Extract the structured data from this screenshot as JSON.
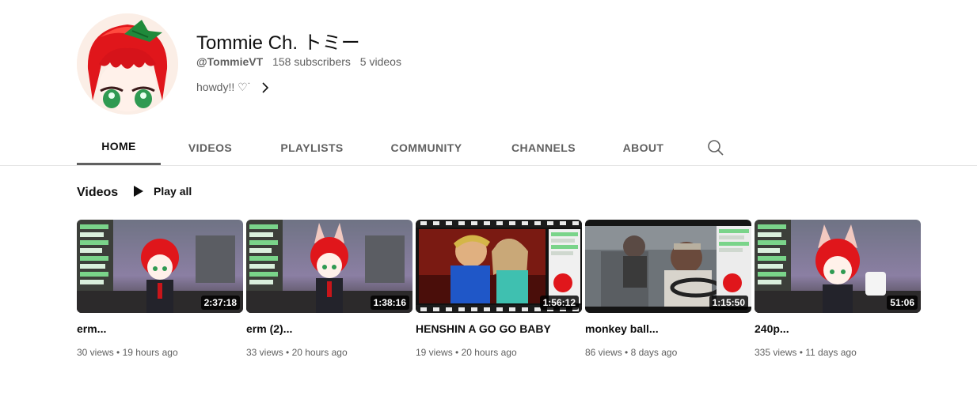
{
  "channel": {
    "name": "Tommie Ch. トミー",
    "handle": "@TommieVT",
    "subscribers": "158 subscribers",
    "video_count": "5 videos",
    "description": "howdy!! ♡˙"
  },
  "tabs": [
    "HOME",
    "VIDEOS",
    "PLAYLISTS",
    "COMMUNITY",
    "CHANNELS",
    "ABOUT"
  ],
  "active_tab": "HOME",
  "section": {
    "title": "Videos",
    "play_all": "Play all"
  },
  "videos": [
    {
      "title": "erm...",
      "duration": "2:37:18",
      "views": "30 views",
      "age": "19 hours ago"
    },
    {
      "title": "erm (2)...",
      "duration": "1:38:16",
      "views": "33 views",
      "age": "20 hours ago"
    },
    {
      "title": "HENSHIN A GO GO BABY",
      "duration": "1:56:12",
      "views": "19 views",
      "age": "20 hours ago"
    },
    {
      "title": "monkey ball...",
      "duration": "1:15:50",
      "views": "86 views",
      "age": "8 days ago"
    },
    {
      "title": "240p...",
      "duration": "51:06",
      "views": "335 views",
      "age": "11 days ago"
    }
  ],
  "icons": {
    "search": "search-icon",
    "play": "play-icon",
    "chevron": "chevron-right-icon"
  },
  "colors": {
    "text_primary": "#0f0f0f",
    "text_secondary": "#606060",
    "active_tab_underline": "#606060",
    "divider": "#e5e5e5"
  }
}
